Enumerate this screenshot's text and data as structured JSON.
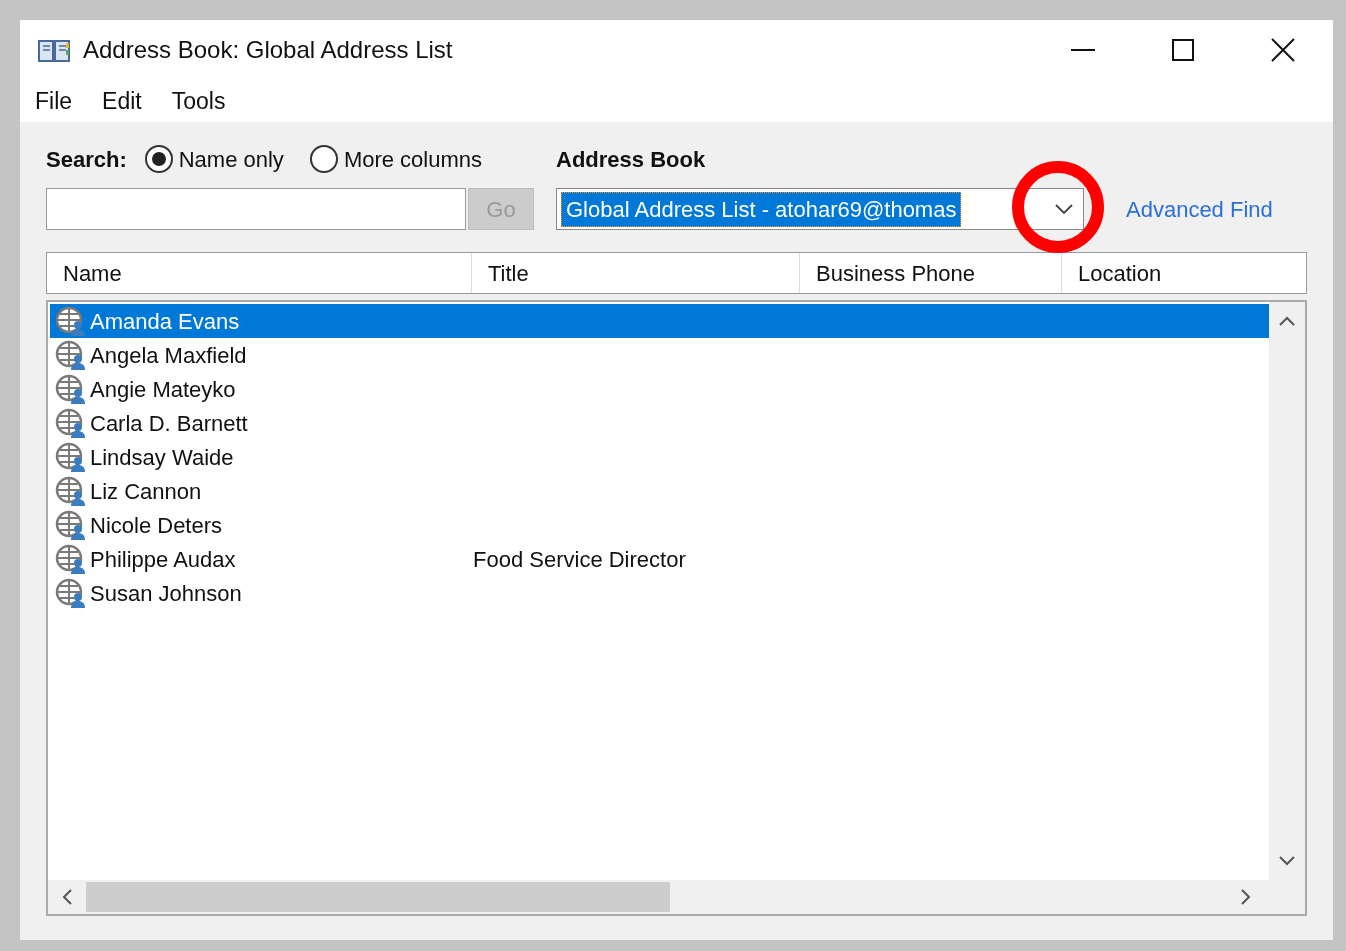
{
  "window": {
    "title": "Address Book: Global Address List"
  },
  "menu": [
    "File",
    "Edit",
    "Tools"
  ],
  "search": {
    "label": "Search:",
    "options": [
      {
        "label": "Name only",
        "selected": true
      },
      {
        "label": "More columns",
        "selected": false
      }
    ],
    "go_button": "Go",
    "go_disabled": true
  },
  "address_book": {
    "label": "Address Book",
    "value": "Global Address List - atohar69@thomas",
    "advanced_find": "Advanced Find"
  },
  "annotation": {
    "kind": "circle",
    "color": "#ff0000"
  },
  "table": {
    "columns": [
      "Name",
      "Title",
      "Business Phone",
      "Location"
    ],
    "rows": [
      {
        "name": "Amanda Evans",
        "title": "",
        "selected": true
      },
      {
        "name": "Angela Maxfield",
        "title": "",
        "selected": false
      },
      {
        "name": "Angie Mateyko",
        "title": "",
        "selected": false
      },
      {
        "name": "Carla D. Barnett",
        "title": "",
        "selected": false
      },
      {
        "name": "Lindsay Waide",
        "title": "",
        "selected": false
      },
      {
        "name": "Liz Cannon",
        "title": "",
        "selected": false
      },
      {
        "name": "Nicole Deters",
        "title": "",
        "selected": false
      },
      {
        "name": "Philippe Audax",
        "title": "Food Service Director",
        "selected": false
      },
      {
        "name": "Susan Johnson",
        "title": "",
        "selected": false
      }
    ]
  }
}
